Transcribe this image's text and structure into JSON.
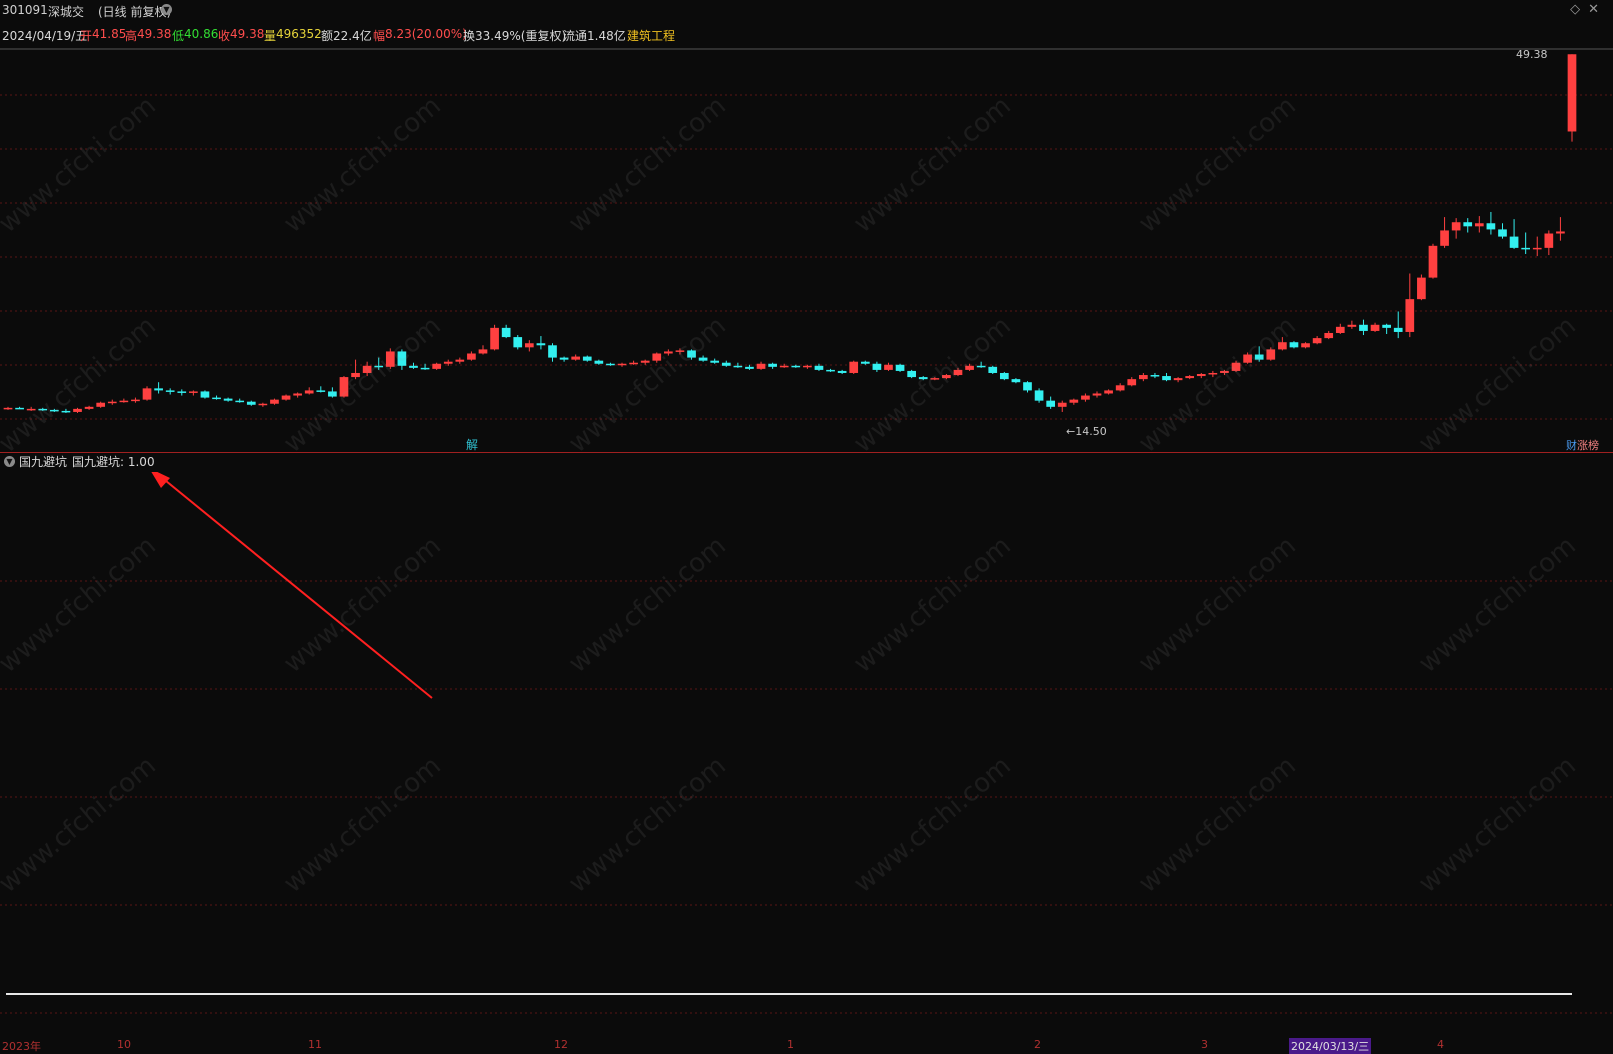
{
  "title": {
    "code": "301091",
    "name": "深城交",
    "mode": "(日线 前复权)"
  },
  "quote": {
    "date": "2024/04/19/五",
    "open_label": "开",
    "open": "41.85",
    "high_label": "高",
    "high": "49.38",
    "low_label": "低",
    "low": "40.86",
    "close_label": "收",
    "close": "49.38",
    "vol_label": "量",
    "vol": "496352",
    "amount_label": "额",
    "amount": "22.4亿",
    "range_label": "幅",
    "range": "8.23(20.00%)",
    "turnover_label": "换",
    "turnover": "33.49%(重复权)",
    "float_label": "流通",
    "float": "1.48亿",
    "sector": "建筑工程"
  },
  "chart_labels": {
    "max": "49.38",
    "min": "←14.50",
    "jie": "解",
    "right_tag_a": "财",
    "right_tag_b": "涨榜"
  },
  "indicator": {
    "name": "国九避坑",
    "value_text": "国九避坑: 1.00"
  },
  "axis_labels": [
    "2023年",
    "10",
    "11",
    "12",
    "1",
    "2",
    "3",
    "2024/03/13/三",
    "4"
  ],
  "watermark_text": "www.cfchi.com",
  "colors": {
    "up": "#ff4040",
    "down": "#33f0f0",
    "grid": "#5a1515",
    "arrow": "#ff2020"
  },
  "chart_data": {
    "type": "candlestick",
    "unit": "price",
    "ylim": [
      14.5,
      49.38
    ],
    "candles": [
      [
        14.9,
        15.0,
        14.7,
        14.9
      ],
      [
        14.9,
        15.0,
        14.8,
        14.8
      ],
      [
        14.8,
        15.0,
        14.6,
        14.8
      ],
      [
        14.8,
        14.9,
        14.6,
        14.7
      ],
      [
        14.7,
        14.8,
        14.5,
        14.6
      ],
      [
        14.6,
        14.8,
        14.4,
        14.5
      ],
      [
        14.5,
        14.9,
        14.4,
        14.8
      ],
      [
        14.8,
        15.1,
        14.7,
        15.0
      ],
      [
        15.0,
        15.5,
        14.9,
        15.4
      ],
      [
        15.4,
        15.7,
        15.2,
        15.5
      ],
      [
        15.5,
        15.8,
        15.4,
        15.6
      ],
      [
        15.6,
        15.9,
        15.4,
        15.7
      ],
      [
        15.7,
        17.0,
        15.6,
        16.8
      ],
      [
        16.8,
        17.4,
        16.3,
        16.6
      ],
      [
        16.6,
        16.8,
        16.2,
        16.5
      ],
      [
        16.5,
        16.7,
        16.1,
        16.4
      ],
      [
        16.4,
        16.6,
        16.1,
        16.5
      ],
      [
        16.5,
        16.6,
        15.8,
        15.9
      ],
      [
        15.9,
        16.1,
        15.7,
        15.8
      ],
      [
        15.8,
        15.9,
        15.5,
        15.6
      ],
      [
        15.6,
        15.8,
        15.4,
        15.5
      ],
      [
        15.5,
        15.6,
        15.1,
        15.2
      ],
      [
        15.2,
        15.4,
        15.0,
        15.3
      ],
      [
        15.3,
        15.8,
        15.2,
        15.7
      ],
      [
        15.7,
        16.2,
        15.6,
        16.1
      ],
      [
        16.1,
        16.4,
        15.9,
        16.3
      ],
      [
        16.3,
        16.9,
        16.2,
        16.6
      ],
      [
        16.6,
        17.0,
        16.4,
        16.5
      ],
      [
        16.5,
        16.9,
        15.9,
        16.0
      ],
      [
        16.0,
        18.0,
        15.9,
        17.9
      ],
      [
        17.9,
        19.6,
        17.7,
        18.3
      ],
      [
        18.3,
        19.4,
        18.0,
        19.0
      ],
      [
        19.0,
        19.8,
        18.6,
        18.9
      ],
      [
        18.9,
        20.7,
        18.7,
        20.4
      ],
      [
        20.4,
        20.6,
        18.6,
        19.0
      ],
      [
        19.0,
        19.3,
        18.7,
        18.8
      ],
      [
        18.8,
        19.2,
        18.6,
        18.7
      ],
      [
        18.7,
        19.3,
        18.6,
        19.2
      ],
      [
        19.2,
        19.6,
        19.0,
        19.4
      ],
      [
        19.4,
        19.8,
        19.2,
        19.6
      ],
      [
        19.6,
        20.4,
        19.5,
        20.2
      ],
      [
        20.2,
        21.0,
        20.1,
        20.6
      ],
      [
        20.6,
        23.0,
        20.5,
        22.7
      ],
      [
        22.7,
        23.0,
        21.7,
        21.8
      ],
      [
        21.8,
        22.0,
        20.6,
        20.8
      ],
      [
        20.8,
        21.5,
        20.4,
        21.2
      ],
      [
        21.2,
        21.9,
        20.6,
        21.0
      ],
      [
        21.0,
        21.2,
        19.4,
        19.8
      ],
      [
        19.8,
        19.9,
        19.4,
        19.6
      ],
      [
        19.6,
        20.1,
        19.5,
        19.9
      ],
      [
        19.9,
        20.0,
        19.4,
        19.5
      ],
      [
        19.5,
        19.6,
        19.1,
        19.2
      ],
      [
        19.2,
        19.3,
        19.0,
        19.1
      ],
      [
        19.1,
        19.3,
        18.9,
        19.2
      ],
      [
        19.2,
        19.5,
        19.1,
        19.3
      ],
      [
        19.3,
        19.6,
        19.1,
        19.5
      ],
      [
        19.5,
        20.3,
        19.3,
        20.2
      ],
      [
        20.2,
        20.6,
        20.0,
        20.4
      ],
      [
        20.4,
        20.7,
        20.1,
        20.5
      ],
      [
        20.5,
        20.6,
        19.6,
        19.8
      ],
      [
        19.8,
        20.0,
        19.4,
        19.5
      ],
      [
        19.5,
        19.7,
        19.2,
        19.3
      ],
      [
        19.3,
        19.5,
        18.9,
        19.0
      ],
      [
        19.0,
        19.3,
        18.8,
        18.9
      ],
      [
        18.9,
        19.1,
        18.6,
        18.7
      ],
      [
        18.7,
        19.4,
        18.6,
        19.2
      ],
      [
        19.2,
        19.3,
        18.7,
        18.9
      ],
      [
        18.9,
        19.2,
        18.8,
        19.0
      ],
      [
        19.0,
        19.1,
        18.8,
        18.9
      ],
      [
        18.9,
        19.1,
        18.7,
        19.0
      ],
      [
        19.0,
        19.2,
        18.5,
        18.6
      ],
      [
        18.6,
        18.7,
        18.4,
        18.5
      ],
      [
        18.5,
        18.6,
        18.2,
        18.3
      ],
      [
        18.3,
        19.5,
        18.2,
        19.4
      ],
      [
        19.4,
        19.5,
        19.1,
        19.2
      ],
      [
        19.2,
        19.4,
        18.4,
        18.6
      ],
      [
        18.6,
        19.3,
        18.5,
        19.1
      ],
      [
        19.1,
        19.2,
        18.4,
        18.5
      ],
      [
        18.5,
        18.6,
        17.8,
        17.9
      ],
      [
        17.9,
        18.0,
        17.6,
        17.7
      ],
      [
        17.7,
        17.9,
        17.6,
        17.8
      ],
      [
        17.8,
        18.2,
        17.7,
        18.1
      ],
      [
        18.1,
        18.8,
        18.0,
        18.6
      ],
      [
        18.6,
        19.2,
        18.5,
        19.0
      ],
      [
        19.0,
        19.4,
        18.8,
        18.9
      ],
      [
        18.9,
        19.0,
        18.2,
        18.3
      ],
      [
        18.3,
        18.4,
        17.6,
        17.7
      ],
      [
        17.7,
        17.8,
        17.3,
        17.4
      ],
      [
        17.4,
        17.5,
        16.4,
        16.6
      ],
      [
        16.6,
        16.8,
        15.4,
        15.6
      ],
      [
        15.6,
        16.0,
        14.8,
        15.0
      ],
      [
        15.0,
        15.6,
        14.5,
        15.4
      ],
      [
        15.4,
        15.8,
        15.2,
        15.7
      ],
      [
        15.7,
        16.3,
        15.5,
        16.1
      ],
      [
        16.1,
        16.5,
        15.9,
        16.3
      ],
      [
        16.3,
        16.7,
        16.2,
        16.6
      ],
      [
        16.6,
        17.3,
        16.5,
        17.1
      ],
      [
        17.1,
        17.9,
        17.0,
        17.7
      ],
      [
        17.7,
        18.3,
        17.5,
        18.1
      ],
      [
        18.1,
        18.3,
        17.8,
        18.0
      ],
      [
        18.0,
        18.3,
        17.5,
        17.6
      ],
      [
        17.6,
        17.9,
        17.4,
        17.8
      ],
      [
        17.8,
        18.1,
        17.7,
        18.0
      ],
      [
        18.0,
        18.3,
        17.8,
        18.2
      ],
      [
        18.2,
        18.5,
        17.9,
        18.3
      ],
      [
        18.3,
        18.6,
        18.1,
        18.5
      ],
      [
        18.5,
        19.5,
        18.4,
        19.3
      ],
      [
        19.3,
        20.3,
        19.2,
        20.1
      ],
      [
        20.1,
        20.9,
        19.4,
        19.6
      ],
      [
        19.6,
        20.8,
        19.5,
        20.6
      ],
      [
        20.6,
        21.8,
        20.5,
        21.3
      ],
      [
        21.3,
        21.4,
        20.7,
        20.8
      ],
      [
        20.8,
        21.3,
        20.7,
        21.2
      ],
      [
        21.2,
        21.9,
        21.1,
        21.7
      ],
      [
        21.7,
        22.4,
        21.6,
        22.2
      ],
      [
        22.2,
        23.1,
        22.1,
        22.8
      ],
      [
        22.8,
        23.4,
        22.6,
        23.0
      ],
      [
        23.0,
        23.5,
        22.0,
        22.4
      ],
      [
        22.4,
        23.2,
        22.3,
        23.0
      ],
      [
        23.0,
        23.1,
        22.1,
        22.7
      ],
      [
        22.7,
        24.3,
        21.7,
        22.3
      ],
      [
        22.3,
        28.0,
        21.8,
        25.5
      ],
      [
        25.5,
        27.9,
        25.4,
        27.6
      ],
      [
        27.6,
        30.9,
        27.5,
        30.7
      ],
      [
        30.7,
        33.5,
        30.5,
        32.2
      ],
      [
        32.2,
        33.4,
        31.4,
        33.0
      ],
      [
        33.0,
        33.4,
        32.0,
        32.6
      ],
      [
        32.6,
        33.6,
        32.0,
        32.9
      ],
      [
        32.9,
        34.0,
        31.8,
        32.3
      ],
      [
        32.3,
        32.9,
        31.4,
        31.6
      ],
      [
        31.6,
        33.3,
        30.4,
        30.5
      ],
      [
        30.5,
        32.0,
        29.9,
        30.4
      ],
      [
        30.4,
        31.6,
        29.7,
        30.5
      ],
      [
        30.5,
        32.2,
        29.8,
        31.9
      ],
      [
        31.9,
        33.5,
        31.2,
        32.1
      ],
      [
        41.85,
        49.38,
        40.86,
        49.38
      ]
    ]
  }
}
